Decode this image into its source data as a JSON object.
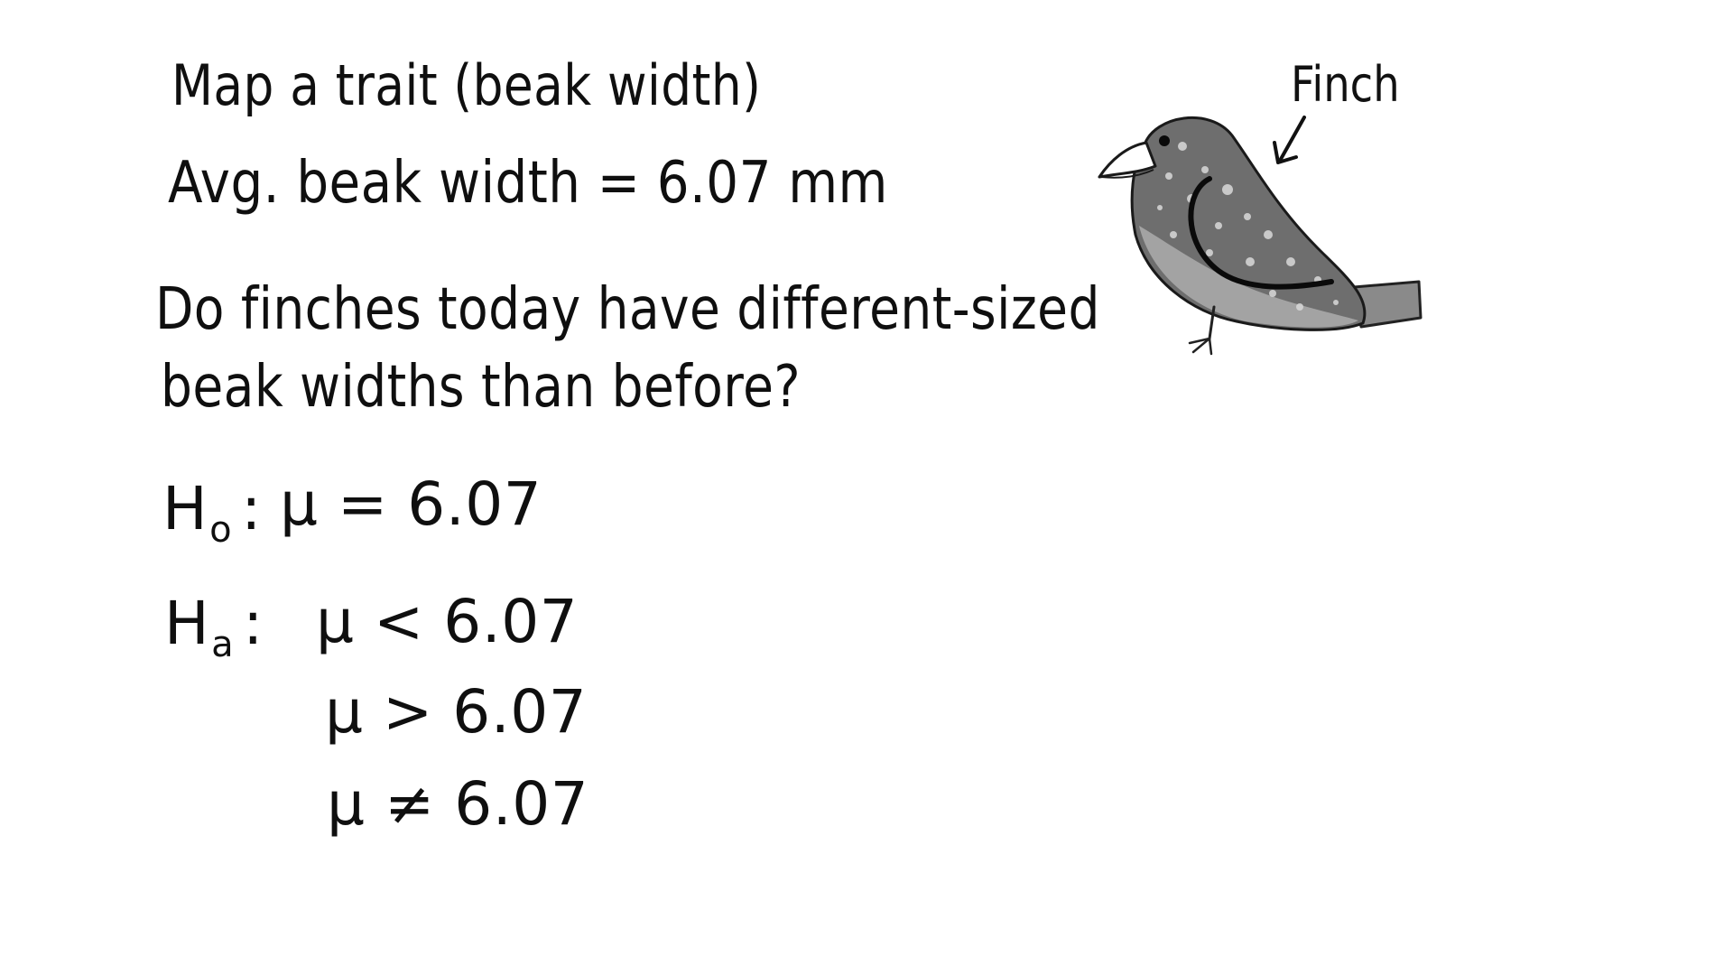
{
  "title": "Map a trait (beak width)",
  "avg_line": "Avg. beak width = 6.07 mm",
  "question": {
    "line1": "Do finches today have different-sized",
    "line2": "beak widths than before?"
  },
  "null_hypothesis": {
    "symbol": "H",
    "subscript": "o",
    "colon": ":",
    "expression": "μ = 6.07"
  },
  "alternative_hypothesis": {
    "symbol": "H",
    "subscript": "a",
    "colon": ":",
    "options": [
      "μ < 6.07",
      "μ > 6.07",
      "μ ≠ 6.07"
    ]
  },
  "illustration": {
    "label": "Finch",
    "icon": "finch-bird-icon"
  }
}
